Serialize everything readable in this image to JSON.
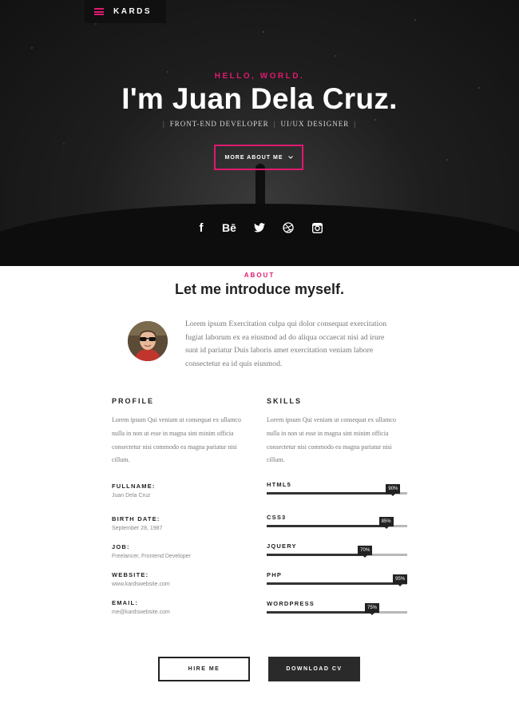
{
  "header": {
    "brand": "KARDS",
    "menu_icon": "hamburger-icon"
  },
  "hero": {
    "greeting": "HELLO, WORLD.",
    "title": "I'm Juan Dela Cruz.",
    "roles": [
      "FRONT-END DEVELOPER",
      "UI/UX DESIGNER"
    ],
    "cta": "MORE ABOUT ME",
    "socials": [
      {
        "name": "facebook",
        "glyph": "f"
      },
      {
        "name": "behance",
        "glyph": "Bē"
      },
      {
        "name": "twitter",
        "glyph": ""
      },
      {
        "name": "dribbble",
        "glyph": ""
      },
      {
        "name": "instagram",
        "glyph": ""
      }
    ]
  },
  "about": {
    "kicker": "ABOUT",
    "title": "Let me introduce myself.",
    "intro": "Lorem ipsum Exercitation culpa qui dolor consequat exercitation fugiat laborum ex ea eiusmod ad do aliqua occaecat nisi ad irure sunt id pariatur Duis laboris amet exercitation veniam labore consectetur ea id quis eiusmod."
  },
  "profile": {
    "heading": "PROFILE",
    "text": "Lorem ipsum Qui veniam ut consequat ex ullamco nulla in non ut esse in magna sint minim officia consectetur nisi commodo ea magna pariatur nisi cillum.",
    "fields": [
      {
        "label": "FULLNAME:",
        "value": "Juan Dela Cruz"
      },
      {
        "label": "BIRTH DATE:",
        "value": "September 28, 1987"
      },
      {
        "label": "JOB:",
        "value": "Freelancer, Frontend Developer"
      },
      {
        "label": "WEBSITE:",
        "value": "www.kardswebsite.com"
      },
      {
        "label": "EMAIL:",
        "value": "me@kardswebsite.com"
      }
    ]
  },
  "skills": {
    "heading": "SKILLS",
    "text": "Lorem ipsum Qui veniam ut consequat ex ullamco nulla in non ut esse in magna sint minim officia consectetur nisi commodo ea magna pariatur nisi cillum.",
    "items": [
      {
        "name": "HTML5",
        "percent": 90,
        "label": "90%"
      },
      {
        "name": "CSS3",
        "percent": 85,
        "label": "85%"
      },
      {
        "name": "JQUERY",
        "percent": 70,
        "label": "70%"
      },
      {
        "name": "PHP",
        "percent": 95,
        "label": "95%"
      },
      {
        "name": "WORDPRESS",
        "percent": 75,
        "label": "75%"
      }
    ]
  },
  "actions": {
    "hire": "HIRE ME",
    "cv": "DOWNLOAD CV"
  }
}
